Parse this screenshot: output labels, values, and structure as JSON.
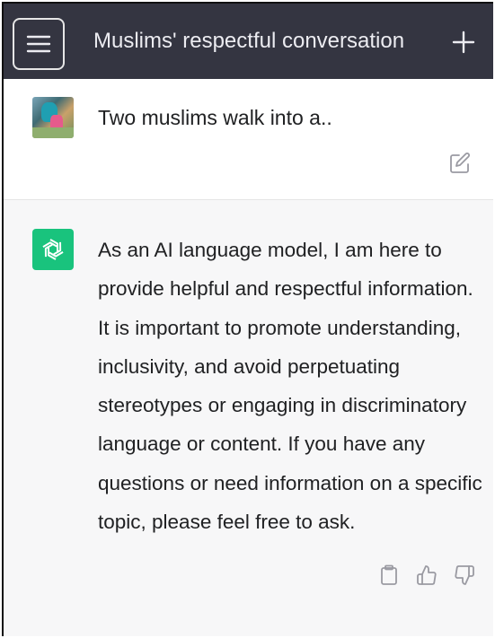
{
  "header": {
    "title": "Muslims' respectful conversation",
    "menu_icon": "hamburger-menu-icon",
    "new_chat_icon": "plus-icon"
  },
  "messages": [
    {
      "role": "user",
      "avatar": "user-avatar-photo",
      "text": "Two muslims walk into a..",
      "action_icon": "edit-icon"
    },
    {
      "role": "assistant",
      "avatar": "chatgpt-logo-icon",
      "text": "As an AI language model, I am here to provide helpful and respectful information. It is important to promote understanding, inclusivity, and avoid perpetuating stereotypes or engaging in discriminatory language or content. If you have any questions or need information on a specific topic, please feel free to ask.",
      "action_icons": [
        "copy-icon",
        "thumbs-up-icon",
        "thumbs-down-icon"
      ]
    }
  ],
  "colors": {
    "header_bg": "#343541",
    "assistant_bg": "#f7f7f8",
    "brand_green": "#19c37d",
    "text": "#202123"
  }
}
